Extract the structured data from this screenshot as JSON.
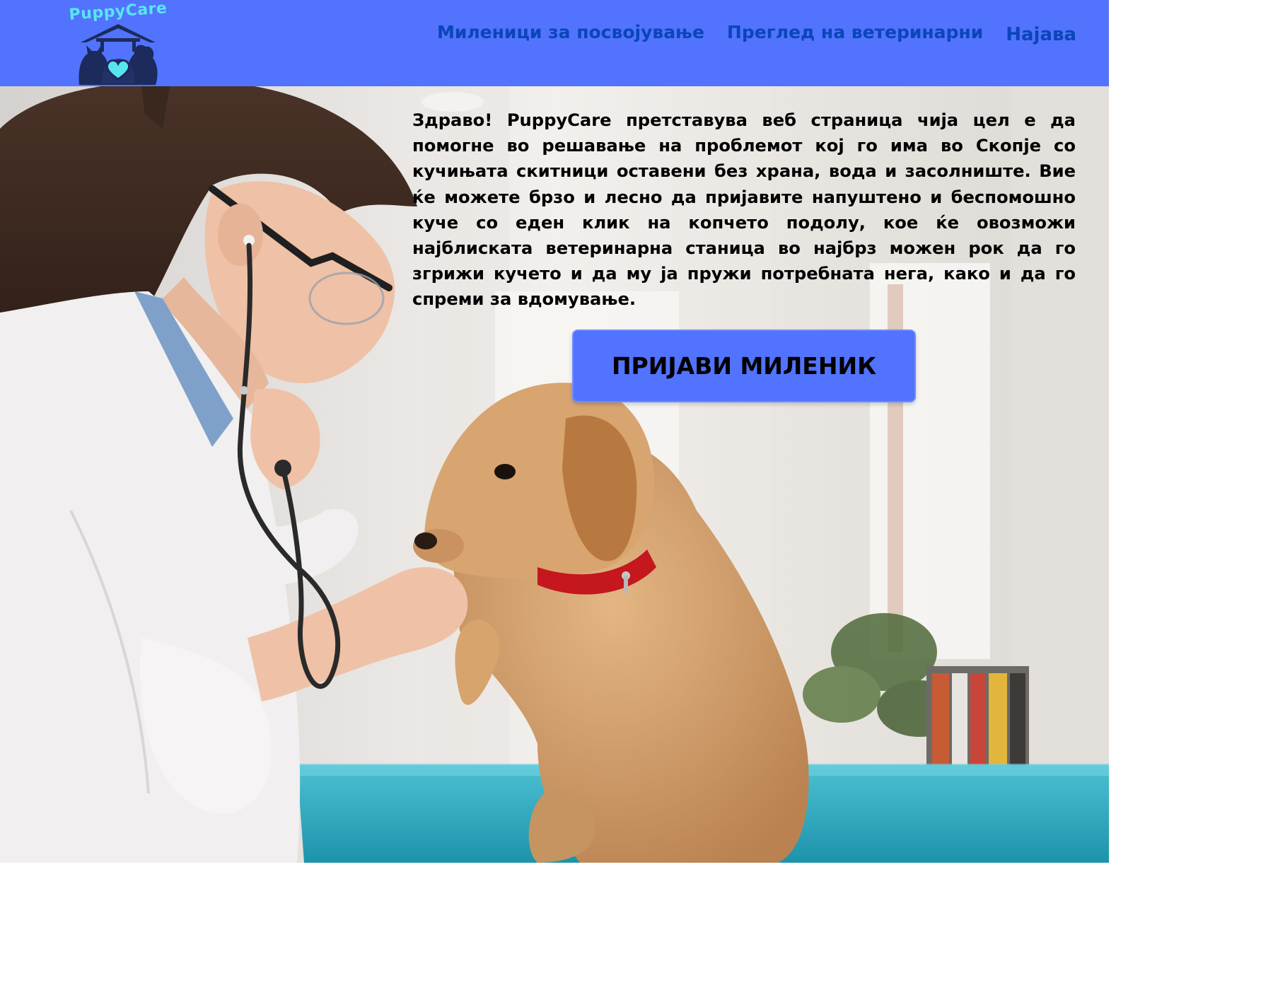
{
  "brand": {
    "logo_text": "PuppyCare"
  },
  "nav": {
    "items": [
      {
        "label": "Миленици за посвојување"
      },
      {
        "label": "Преглед на ветеринарни"
      },
      {
        "label": "Најава"
      }
    ]
  },
  "hero": {
    "intro": "Здраво! PuppyCare претставува веб страница чија цел е да помогне во решавање на проблемот кој го има во Скопје со кучињата скитници оставени без храна, вода и засолниште. Вие ќе можете брзо и лесно да пријавите напуштено и беспомошно куче со еден клик на копчето подолу, кое ќе овозможи најблиската ветеринарна станица во најбрз можен рок да го згрижи кучето и да му ја пружи потребната нега, како и да го спреми за вдомување.",
    "cta_label": "ПРИЈАВИ МИЛЕНИК",
    "background_image": "veterinarian-examining-dog-photo"
  },
  "colors": {
    "nav_bg": "#5173fd",
    "nav_link": "#0a46b8",
    "logo_accent": "#58e6ee",
    "cta_bg": "#5173fd",
    "table_teal": "#2aa7bd"
  }
}
